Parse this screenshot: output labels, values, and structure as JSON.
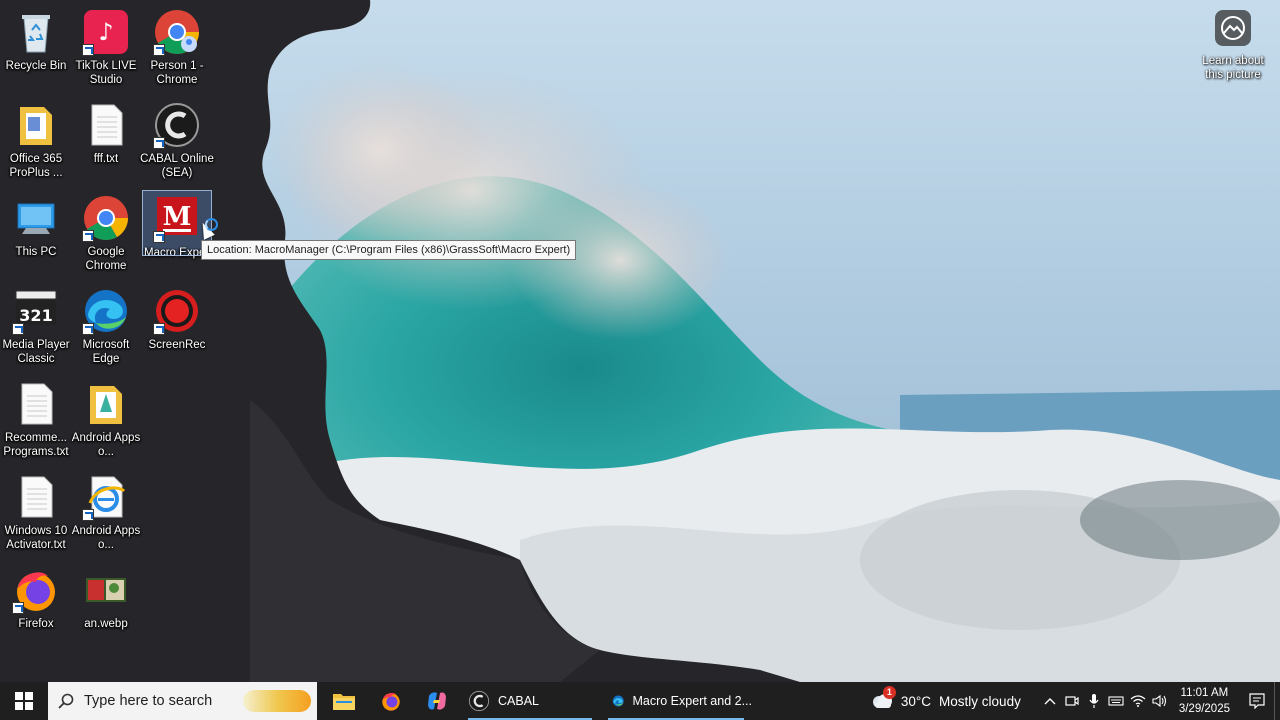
{
  "desktop": {
    "icons": [
      {
        "label": "Recycle Bin",
        "icon": "recycle-bin-icon"
      },
      {
        "label": "TikTok LIVE Studio",
        "icon": "tiktok-live-icon"
      },
      {
        "label": "Person 1 - Chrome",
        "icon": "chrome-profile-icon"
      },
      {
        "label": "Office 365 ProPlus ...",
        "icon": "folder-icon"
      },
      {
        "label": "fff.txt",
        "icon": "text-file-icon"
      },
      {
        "label": "CABAL Online (SEA)",
        "icon": "cabal-icon"
      },
      {
        "label": "This PC",
        "icon": "computer-icon"
      },
      {
        "label": "Google Chrome",
        "icon": "chrome-icon"
      },
      {
        "label": "Macro Expe",
        "icon": "macro-expert-icon"
      },
      {
        "label": "Media Player Classic",
        "icon": "media-player-icon"
      },
      {
        "label": "Microsoft Edge",
        "icon": "edge-icon"
      },
      {
        "label": "ScreenRec",
        "icon": "screenrec-icon"
      },
      {
        "label": "Recomme... Programs.txt",
        "icon": "text-file-icon"
      },
      {
        "label": "Android Apps o...",
        "icon": "folder-icon"
      },
      {
        "label": "Windows 10 Activator.txt",
        "icon": "text-file-icon"
      },
      {
        "label": "Android Apps o...",
        "icon": "internet-explorer-icon"
      },
      {
        "label": "Firefox",
        "icon": "firefox-icon"
      },
      {
        "label": "an.webp",
        "icon": "image-file-icon"
      }
    ],
    "tooltip": "Location: MacroManager (C:\\Program Files (x86)\\GrassSoft\\Macro Expert)",
    "learn_about": "Learn about this picture"
  },
  "taskbar": {
    "search_placeholder": "Type here to search",
    "apps": [
      {
        "label": "",
        "icon": "file-explorer-icon"
      },
      {
        "label": "",
        "icon": "firefox-icon"
      },
      {
        "label": "",
        "icon": "copilot-icon"
      },
      {
        "label": "CABAL",
        "icon": "cabal-icon"
      },
      {
        "label": "Macro Expert and 2...",
        "icon": "edge-icon"
      }
    ],
    "weather": {
      "temp": "30°C",
      "condition": "Mostly cloudy",
      "badge": "1"
    },
    "clock": {
      "time": "11:01 AM",
      "date": "3/29/2025"
    }
  },
  "colors": {
    "taskbar": "#1f1f1f",
    "accent": "#76b9ed",
    "selection": "#608cc8"
  }
}
